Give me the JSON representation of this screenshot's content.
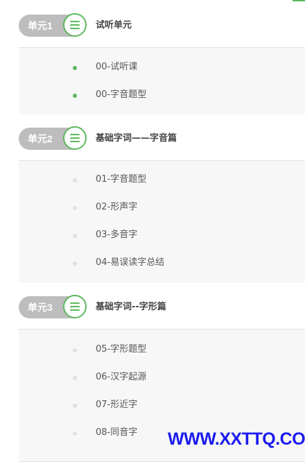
{
  "units": [
    {
      "badge": "单元1",
      "title": "试听单元",
      "lessons": [
        {
          "title": "00-试听课",
          "status": "active"
        },
        {
          "title": "00-字音题型",
          "status": "active"
        }
      ]
    },
    {
      "badge": "单元2",
      "title": "基础字词——字音篇",
      "lessons": [
        {
          "title": "01-字音题型",
          "status": "inactive"
        },
        {
          "title": "02-形声字",
          "status": "inactive"
        },
        {
          "title": "03-多音字",
          "status": "inactive"
        },
        {
          "title": "04-易误读字总结",
          "status": "inactive"
        }
      ]
    },
    {
      "badge": "单元3",
      "title": "基础字词--字形篇",
      "lessons": [
        {
          "title": "05-字形题型",
          "status": "inactive"
        },
        {
          "title": "06-汉字起源",
          "status": "inactive"
        },
        {
          "title": "07-形近字",
          "status": "inactive"
        },
        {
          "title": "08-同音字",
          "status": "inactive"
        }
      ]
    }
  ],
  "watermark": "WWW.XXTTQ.COM",
  "colors": {
    "accent": "#5cb85c",
    "badge_bg": "#bdbdbd",
    "watermark": "#1a1af0"
  },
  "icons": {
    "unit_icon": "menu-list-icon"
  }
}
